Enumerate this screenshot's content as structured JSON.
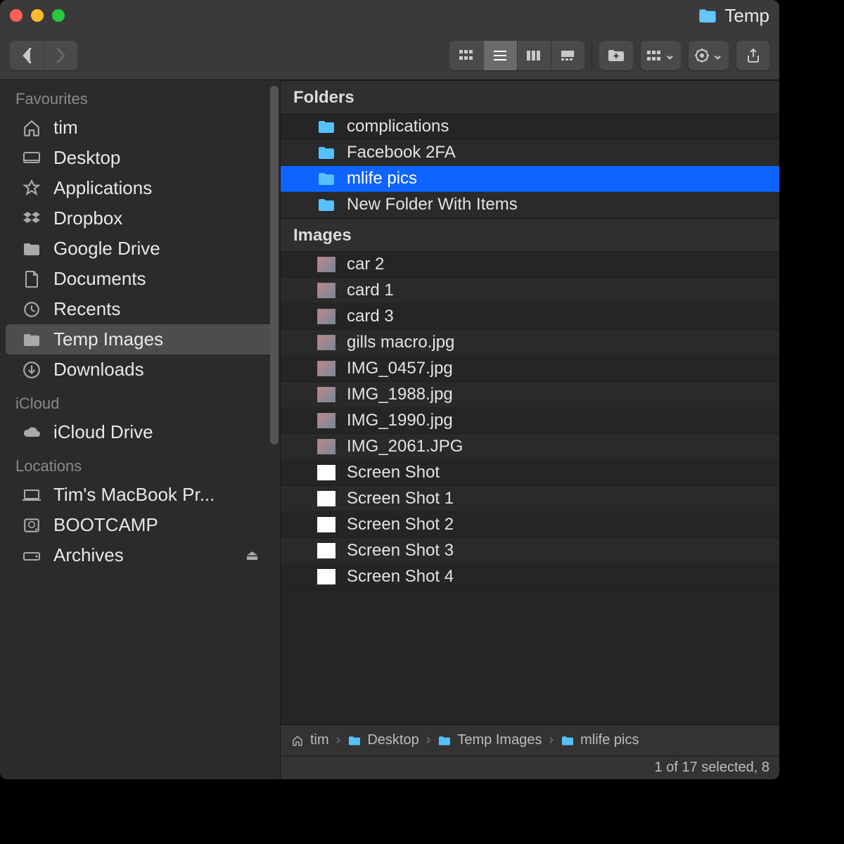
{
  "window": {
    "title": "Temp"
  },
  "sidebar": {
    "sections": [
      {
        "title": "Favourites",
        "items": [
          {
            "icon": "home",
            "label": "tim"
          },
          {
            "icon": "desktop",
            "label": "Desktop"
          },
          {
            "icon": "applications",
            "label": "Applications"
          },
          {
            "icon": "dropbox",
            "label": "Dropbox"
          },
          {
            "icon": "folder",
            "label": "Google Drive"
          },
          {
            "icon": "documents",
            "label": "Documents"
          },
          {
            "icon": "recents",
            "label": "Recents"
          },
          {
            "icon": "folder",
            "label": "Temp Images",
            "selected": true
          },
          {
            "icon": "downloads",
            "label": "Downloads"
          }
        ]
      },
      {
        "title": "iCloud",
        "items": [
          {
            "icon": "cloud",
            "label": "iCloud Drive"
          }
        ]
      },
      {
        "title": "Locations",
        "items": [
          {
            "icon": "laptop",
            "label": "Tim's MacBook Pr..."
          },
          {
            "icon": "hdd",
            "label": "BOOTCAMP"
          },
          {
            "icon": "drive",
            "label": "Archives",
            "eject": true
          }
        ]
      }
    ]
  },
  "content": {
    "groups": [
      {
        "header": "Folders",
        "items": [
          {
            "type": "folder",
            "name": "complications"
          },
          {
            "type": "folder",
            "name": "Facebook 2FA"
          },
          {
            "type": "folder",
            "name": "mlife pics",
            "selected": true
          },
          {
            "type": "folder",
            "name": "New Folder With Items"
          }
        ]
      },
      {
        "header": "Images",
        "items": [
          {
            "type": "image",
            "name": "car 2"
          },
          {
            "type": "image",
            "name": "card 1"
          },
          {
            "type": "image",
            "name": "card 3"
          },
          {
            "type": "image",
            "name": "gills macro.jpg"
          },
          {
            "type": "image",
            "name": "IMG_0457.jpg"
          },
          {
            "type": "image",
            "name": "IMG_1988.jpg"
          },
          {
            "type": "image",
            "name": "IMG_1990.jpg"
          },
          {
            "type": "image",
            "name": "IMG_2061.JPG"
          },
          {
            "type": "doc",
            "name": "Screen Shot"
          },
          {
            "type": "doc",
            "name": "Screen Shot 1"
          },
          {
            "type": "doc",
            "name": "Screen Shot 2"
          },
          {
            "type": "doc",
            "name": "Screen Shot 3"
          },
          {
            "type": "doc",
            "name": "Screen Shot 4"
          }
        ]
      }
    ]
  },
  "pathbar": [
    {
      "icon": "home",
      "label": "tim"
    },
    {
      "icon": "folder",
      "label": "Desktop"
    },
    {
      "icon": "folder",
      "label": "Temp Images"
    },
    {
      "icon": "folder",
      "label": "mlife pics"
    }
  ],
  "status": "1 of 17 selected, 8"
}
